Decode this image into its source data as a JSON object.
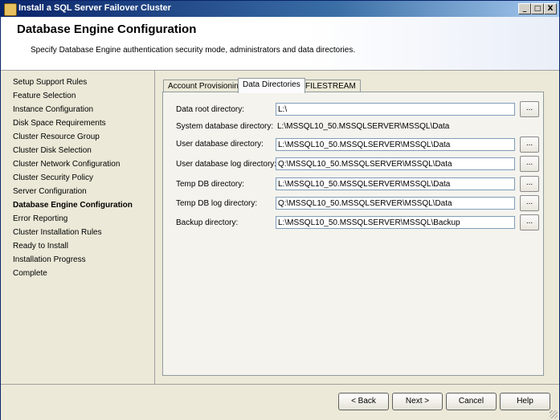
{
  "window": {
    "title": "Install a SQL Server Failover Cluster",
    "minimize": "_",
    "maximize": "□",
    "close": "X"
  },
  "header": {
    "title": "Database Engine Configuration",
    "subtitle": "Specify Database Engine authentication security mode, administrators and data directories."
  },
  "nav": {
    "items": [
      {
        "label": "Setup Support Rules"
      },
      {
        "label": "Feature Selection"
      },
      {
        "label": "Instance Configuration"
      },
      {
        "label": "Disk Space Requirements"
      },
      {
        "label": "Cluster Resource Group"
      },
      {
        "label": "Cluster Disk Selection"
      },
      {
        "label": "Cluster Network Configuration"
      },
      {
        "label": "Cluster Security Policy"
      },
      {
        "label": "Server Configuration"
      },
      {
        "label": "Database Engine Configuration"
      },
      {
        "label": "Error Reporting"
      },
      {
        "label": "Cluster Installation Rules"
      },
      {
        "label": "Ready to Install"
      },
      {
        "label": "Installation Progress"
      },
      {
        "label": "Complete"
      }
    ]
  },
  "tabs": [
    {
      "label": "Account Provisioning"
    },
    {
      "label": "Data Directories"
    },
    {
      "label": "FILESTREAM"
    }
  ],
  "directories": {
    "data_root": {
      "label": "Data root directory:",
      "value": "L:\\"
    },
    "system_db": {
      "label": "System database directory:",
      "value": "L:\\MSSQL10_50.MSSQLSERVER\\MSSQL\\Data"
    },
    "user_db": {
      "label": "User database directory:",
      "value": "L:\\MSSQL10_50.MSSQLSERVER\\MSSQL\\Data"
    },
    "user_db_log": {
      "label": "User database log directory:",
      "value": "Q:\\MSSQL10_50.MSSQLSERVER\\MSSQL\\Data"
    },
    "temp_db": {
      "label": "Temp DB directory:",
      "value": "L:\\MSSQL10_50.MSSQLSERVER\\MSSQL\\Data"
    },
    "temp_db_log": {
      "label": "Temp DB log directory:",
      "value": "Q:\\MSSQL10_50.MSSQLSERVER\\MSSQL\\Data"
    },
    "backup": {
      "label": "Backup directory:",
      "value": "L:\\MSSQL10_50.MSSQLSERVER\\MSSQL\\Backup"
    },
    "browse_label": "..."
  },
  "footer": {
    "back": "< Back",
    "next": "Next >",
    "cancel": "Cancel",
    "help": "Help"
  }
}
